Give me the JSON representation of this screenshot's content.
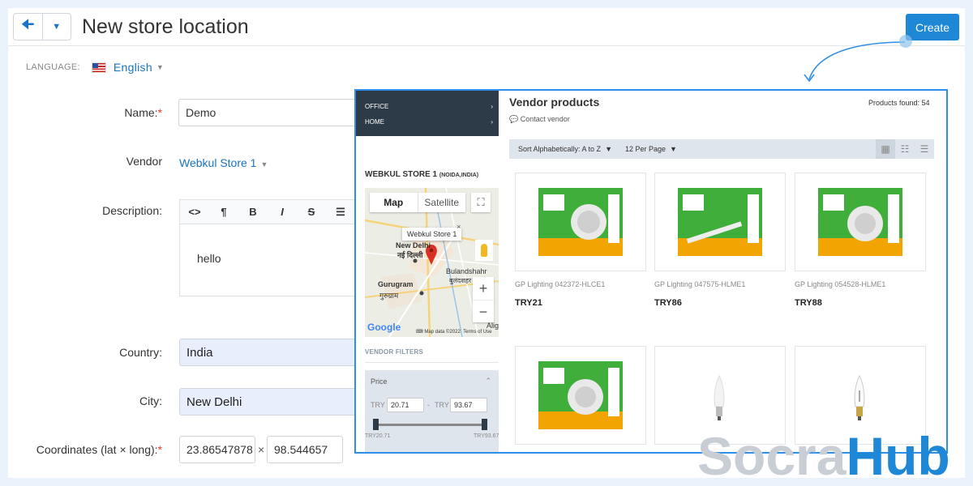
{
  "header": {
    "title": "New store location",
    "back_icon": "arrow-left-icon",
    "menu_icon": "caret-down-icon",
    "create_label": "Create"
  },
  "language": {
    "label": "LANGUAGE:",
    "value": "English",
    "flag_icon": "us-flag-icon"
  },
  "form": {
    "name_label": "Name:",
    "name_value": "Demo",
    "vendor_label": "Vendor",
    "vendor_value": "Webkul Store 1",
    "description_label": "Description:",
    "description_toolbar": [
      "<>",
      "¶",
      "B",
      "I",
      "S",
      "list"
    ],
    "description_value": "hello",
    "country_label": "Country:",
    "country_value": "India",
    "city_label": "City:",
    "city_value": "New Delhi",
    "coords_label": "Coordinates (lat × long):",
    "lat_value": "23.86547878",
    "times": "×",
    "long_value": "98.544657"
  },
  "storefront": {
    "menu": [
      {
        "label": "OFFICE"
      },
      {
        "label": "HOME"
      }
    ],
    "store_name": "WEBKUL STORE 1",
    "store_location": "(NOIDA,INDIA)",
    "map": {
      "tab_map": "Map",
      "tab_satellite": "Satellite",
      "popup": "Webkul Store 1",
      "labels": [
        "New Delhi",
        "नई दिल्ली",
        "Gurugram",
        "गुरुग्राम",
        "Bulandshahr",
        "बुलंदशहर",
        "Alig"
      ],
      "zoom_in": "+",
      "zoom_out": "−",
      "google": "Google",
      "map_data": "Map data ©2022",
      "terms": "Terms of Use"
    },
    "filters_title": "VENDOR FILTERS",
    "price": {
      "title": "Price",
      "currency": "TRY",
      "dash": "-",
      "min": "20.71",
      "max": "93.67",
      "range_min": "TRY20.71",
      "range_max": "TRY93.67"
    },
    "products_title": "Vendor products",
    "contact": "Contact vendor",
    "products_found": "Products found: 54",
    "sort": "Sort Alphabetically: A to Z",
    "per_page": "12 Per Page",
    "products": [
      {
        "name": "GP Lighting 042372-HLCE1",
        "price": "TRY21"
      },
      {
        "name": "GP Lighting 047575-HLME1",
        "price": "TRY86"
      },
      {
        "name": "GP Lighting 054528-HLME1",
        "price": "TRY88"
      },
      {
        "name": "",
        "price": ""
      },
      {
        "name": "",
        "price": ""
      },
      {
        "name": "",
        "price": ""
      }
    ]
  },
  "watermark": {
    "part1": "Socra",
    "part2": "Hub"
  },
  "colors": {
    "accent": "#1e88d6",
    "overlay_border": "#2e8ee8",
    "menu_dark": "#2d3a47",
    "required": "#e33333"
  }
}
